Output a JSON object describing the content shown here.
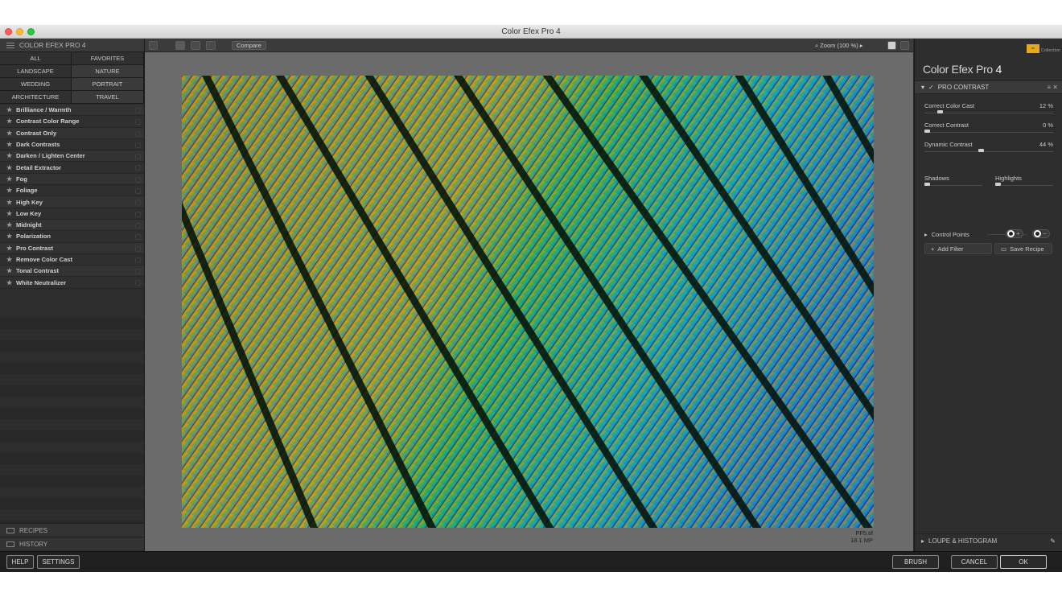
{
  "window": {
    "title": "Color Efex Pro 4"
  },
  "left_panel": {
    "header": "COLOR EFEX PRO 4",
    "categories": [
      "ALL",
      "FAVORITES",
      "LANDSCAPE",
      "NATURE",
      "WEDDING",
      "PORTRAIT",
      "ARCHITECTURE",
      "TRAVEL"
    ],
    "filters": [
      "Brilliance / Warmth",
      "Contrast Color Range",
      "Contrast Only",
      "Dark Contrasts",
      "Darken / Lighten Center",
      "Detail Extractor",
      "Fog",
      "Foliage",
      "High Key",
      "Low Key",
      "Midnight",
      "Polarization",
      "Pro Contrast",
      "Remove Color Cast",
      "Tonal Contrast",
      "White Neutralizer"
    ],
    "recipes": "RECIPES",
    "history": "HISTORY"
  },
  "toolbar": {
    "compare": "Compare",
    "zoom": "Zoom (100 %)"
  },
  "image_info": {
    "filename": "PF5.tif",
    "size": "18.1 MP"
  },
  "right_panel": {
    "logo_text": "Collection",
    "brand_name": "Color Efex Pro",
    "brand_version": "4",
    "filter_name": "PRO CONTRAST",
    "sliders": [
      {
        "label": "Correct Color Cast",
        "value": "12 %",
        "level": 0.12
      },
      {
        "label": "Correct Contrast",
        "value": "0 %",
        "level": 0.0
      },
      {
        "label": "Dynamic Contrast",
        "value": "44 %",
        "level": 0.44
      }
    ],
    "shadows": {
      "label": "Shadows",
      "level": 0.0
    },
    "highlights": {
      "label": "Highlights",
      "level": 0.0
    },
    "control_points": "Control Points",
    "add_filter": "Add Filter",
    "save_recipe": "Save Recipe",
    "loupe": "LOUPE & HISTOGRAM"
  },
  "bottom_bar": {
    "help": "HELP",
    "settings": "SETTINGS",
    "brush": "BRUSH",
    "cancel": "CANCEL",
    "ok": "OK"
  }
}
